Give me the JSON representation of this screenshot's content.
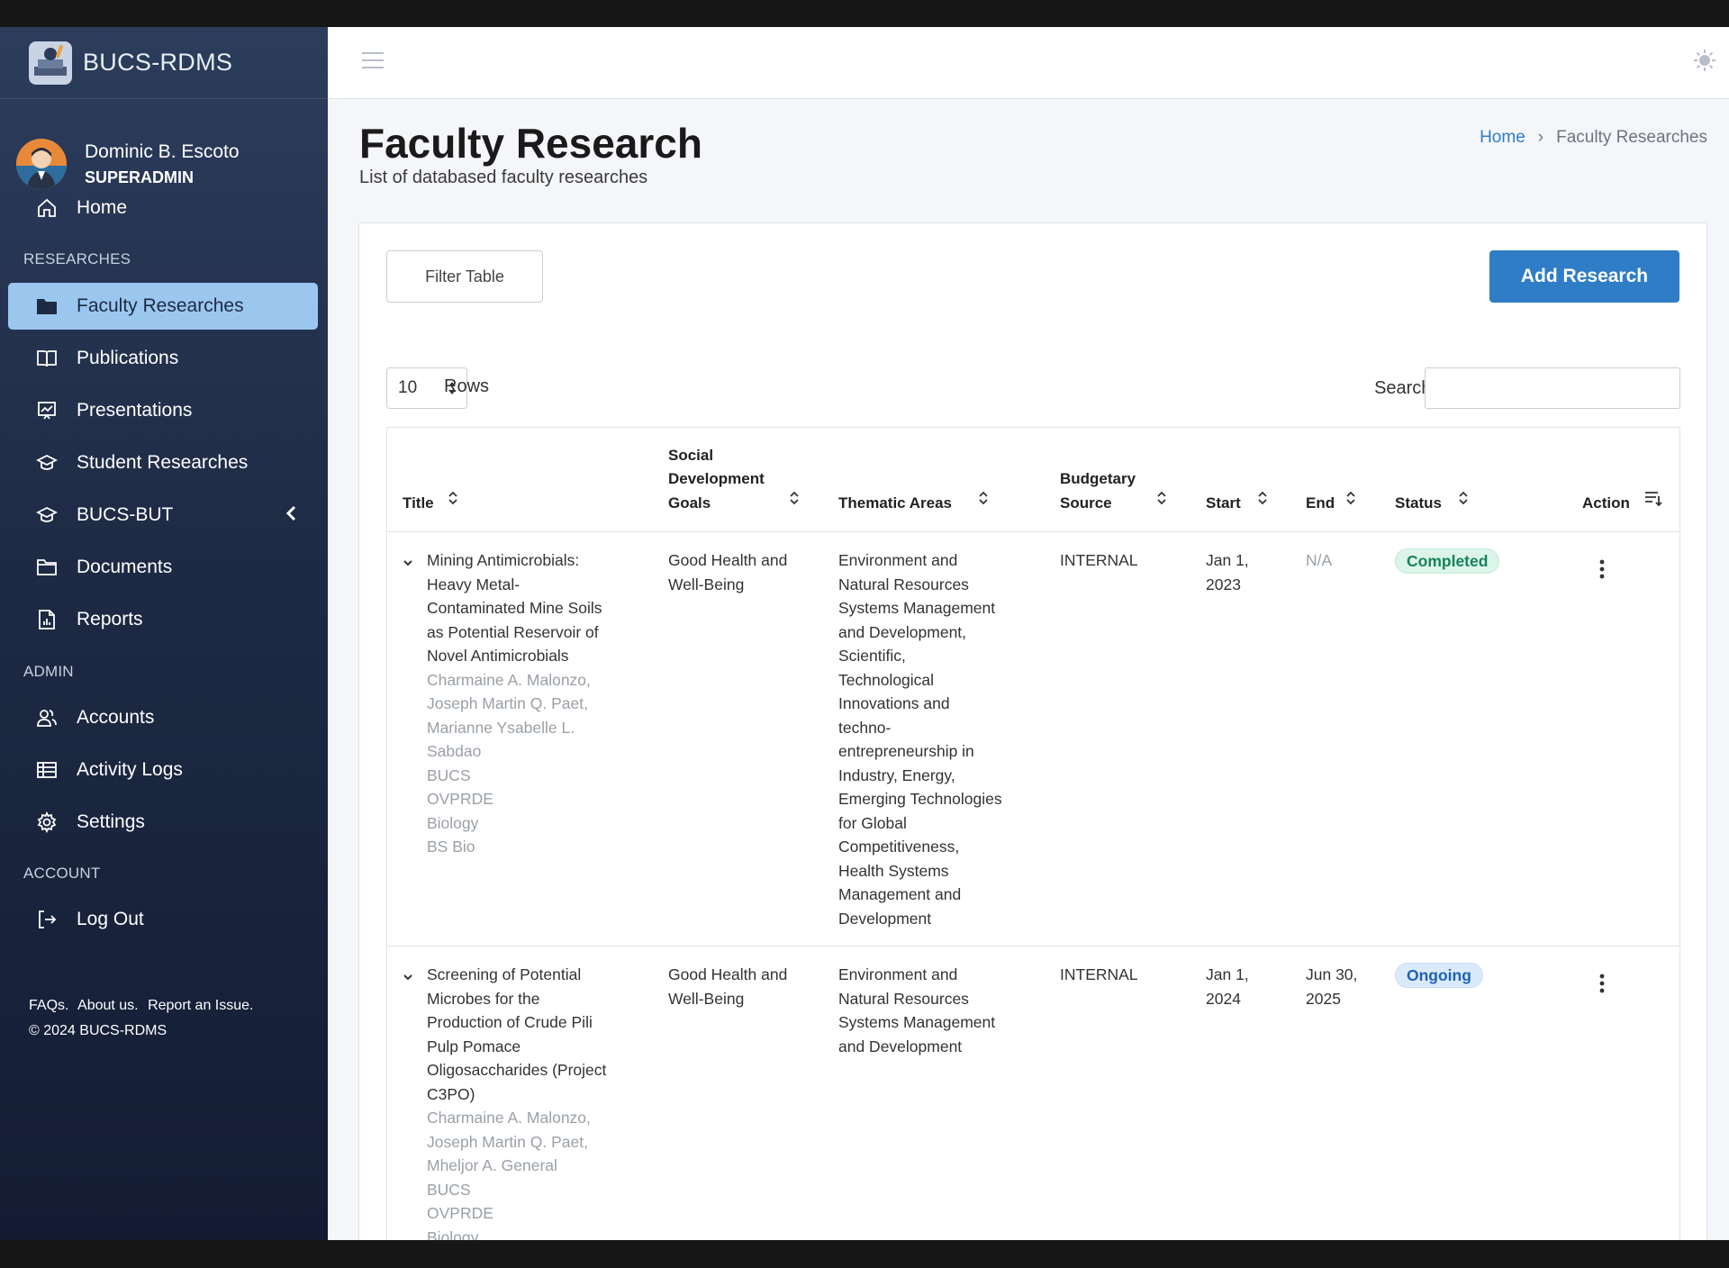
{
  "app": {
    "name": "BUCS-RDMS"
  },
  "user": {
    "name": "Dominic B. Escoto",
    "role": "SUPERADMIN"
  },
  "nav": {
    "home": "Home",
    "section_researches": "RESEARCHES",
    "faculty_researches": "Faculty Researches",
    "publications": "Publications",
    "presentations": "Presentations",
    "student_researches": "Student Researches",
    "bucs_but": "BUCS-BUT",
    "documents": "Documents",
    "reports": "Reports",
    "section_admin": "ADMIN",
    "accounts": "Accounts",
    "activity_logs": "Activity Logs",
    "settings": "Settings",
    "section_account": "ACCOUNT",
    "log_out": "Log Out"
  },
  "footer": {
    "faqs": "FAQs.",
    "about": "About us.",
    "report": "Report an Issue.",
    "copyright": "© 2024 BUCS-RDMS"
  },
  "page": {
    "title": "Faculty Research",
    "subtitle": "List of databased faculty researches",
    "breadcrumb_home": "Home",
    "breadcrumb_current": "Faculty Researches"
  },
  "toolbar": {
    "filter_label": "Filter Table",
    "add_label": "Add Research",
    "rows_value": "10",
    "rows_label": "Rows",
    "search_label": "Search:",
    "search_value": ""
  },
  "table": {
    "columns": {
      "title": "Title",
      "sdg": [
        "Social",
        "Development",
        "Goals"
      ],
      "thematic": "Thematic Areas",
      "budget": [
        "Budgetary",
        "Source"
      ],
      "start": "Start",
      "end": "End",
      "status": "Status",
      "action": "Action"
    },
    "rows": [
      {
        "title_lines": [
          "Mining Antimicrobials:",
          "Heavy Metal-",
          "Contaminated Mine Soils",
          "as Potential Reservoir of",
          "Novel Antimicrobials"
        ],
        "meta_lines": [
          "Charmaine A. Malonzo,",
          "Joseph Martin Q. Paet,",
          "Marianne Ysabelle L.",
          "Sabdao",
          "BUCS",
          "OVPRDE",
          "Biology",
          "BS Bio"
        ],
        "sdg_lines": [
          "Good Health and",
          "Well-Being"
        ],
        "thematic_lines": [
          "Environment and",
          "Natural Resources",
          "Systems Management",
          "and Development,",
          "Scientific,",
          "Technological",
          "Innovations and",
          "techno-",
          "entrepreneurship in",
          "Industry, Energy,",
          "Emerging Technologies",
          "for Global",
          "Competitiveness,",
          "Health Systems",
          "Management and",
          "Development"
        ],
        "budget": "INTERNAL",
        "start_lines": [
          "Jan 1,",
          "2023"
        ],
        "end_lines": [
          "N/A"
        ],
        "status": "Completed"
      },
      {
        "title_lines": [
          "Screening of Potential",
          "Microbes for the",
          "Production of Crude Pili",
          "Pulp Pomace",
          "Oligosaccharides (Project",
          "C3PO)"
        ],
        "meta_lines": [
          "Charmaine A. Malonzo,",
          "Joseph Martin Q. Paet,",
          "Mheljor A. General",
          "BUCS",
          "OVPRDE",
          "Biology"
        ],
        "sdg_lines": [
          "Good Health and",
          "Well-Being"
        ],
        "thematic_lines": [
          "Environment and",
          "Natural Resources",
          "Systems Management",
          "and Development"
        ],
        "budget": "INTERNAL",
        "start_lines": [
          "Jan 1,",
          "2024"
        ],
        "end_lines": [
          "Jun 30,",
          "2025"
        ],
        "status": "Ongoing"
      }
    ]
  },
  "colors": {
    "primary": "#2f7dc6",
    "sidebar_active": "#9bc7ef",
    "sidebar_bg": "#1e2a44"
  },
  "icons": [
    "home-icon",
    "folder-icon",
    "book-open-icon",
    "presentation-icon",
    "graduation-cap-icon",
    "folder-outline-icon",
    "report-icon",
    "users-icon",
    "table-icon",
    "gear-icon",
    "logout-icon",
    "hamburger-icon",
    "sun-icon",
    "sort-icon",
    "chevron-down-icon",
    "kebab-icon"
  ]
}
